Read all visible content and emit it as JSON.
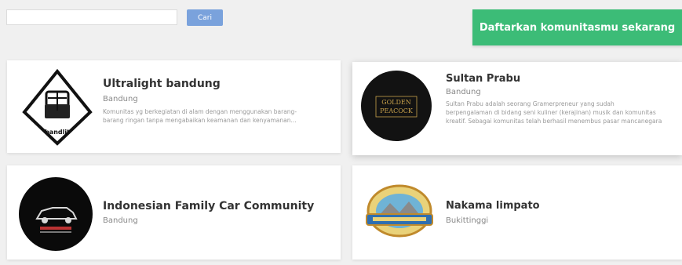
{
  "search": {
    "placeholder": "",
    "button_label": "Cari"
  },
  "register_button_label": "Daftarkan komunitasmu sekarang",
  "communities": [
    {
      "name": "Ultralight bandung",
      "city": "Bandung",
      "description": "Komunitas yg berkegiatan di alam dengan menggunakan barang-barang ringan tanpa mengabaikan keamanan dan kenyamanan...",
      "logo": {
        "icon": "backpack-in-triangle-icon",
        "text": "bandlit"
      }
    },
    {
      "name": "Sultan Prabu",
      "city": "Bandung",
      "description": "Sultan Prabu adalah seorang Gramerpreneur yang sudah berpengalaman di bidang seni kuliner (kerajinan) musik dan komunitas kreatif. Sebagai komunitas telah berhasil menembus pasar mancanegara",
      "logo": {
        "icon": "golden-peacock-logo",
        "text": "GOLDEN PEACOCK",
        "color": "#c9a24b"
      }
    },
    {
      "name": "Indonesian Family Car Community",
      "city": "Bandung",
      "description": "",
      "logo": {
        "icon": "car-community-logo"
      }
    },
    {
      "name": "Nakama limpato",
      "city": "Bukittinggi",
      "description": "",
      "logo": {
        "icon": "nakama-limpato-badge"
      }
    }
  ],
  "colors": {
    "page_background": "#f0f0f0",
    "register_button": "#3cbc77",
    "search_button": "#7aa2dc",
    "card_background": "#ffffff"
  }
}
